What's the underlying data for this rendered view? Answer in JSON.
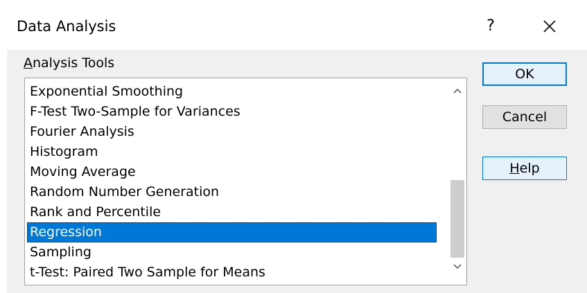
{
  "dialog": {
    "title": "Data Analysis",
    "help_glyph": "?",
    "close_icon": "close-icon"
  },
  "analysis_tools": {
    "label_accel": "A",
    "label_rest": "nalysis Tools",
    "items": [
      "Exponential Smoothing",
      "F-Test Two-Sample for Variances",
      "Fourier Analysis",
      "Histogram",
      "Moving Average",
      "Random Number Generation",
      "Rank and Percentile",
      "Regression",
      "Sampling",
      "t-Test: Paired Two Sample for Means"
    ],
    "selected": "Regression"
  },
  "buttons": {
    "ok": "OK",
    "cancel": "Cancel",
    "help_accel": "H",
    "help_rest": "elp"
  },
  "colors": {
    "selection": "#0078d7",
    "dialog_bg": "#f0f0f0"
  }
}
